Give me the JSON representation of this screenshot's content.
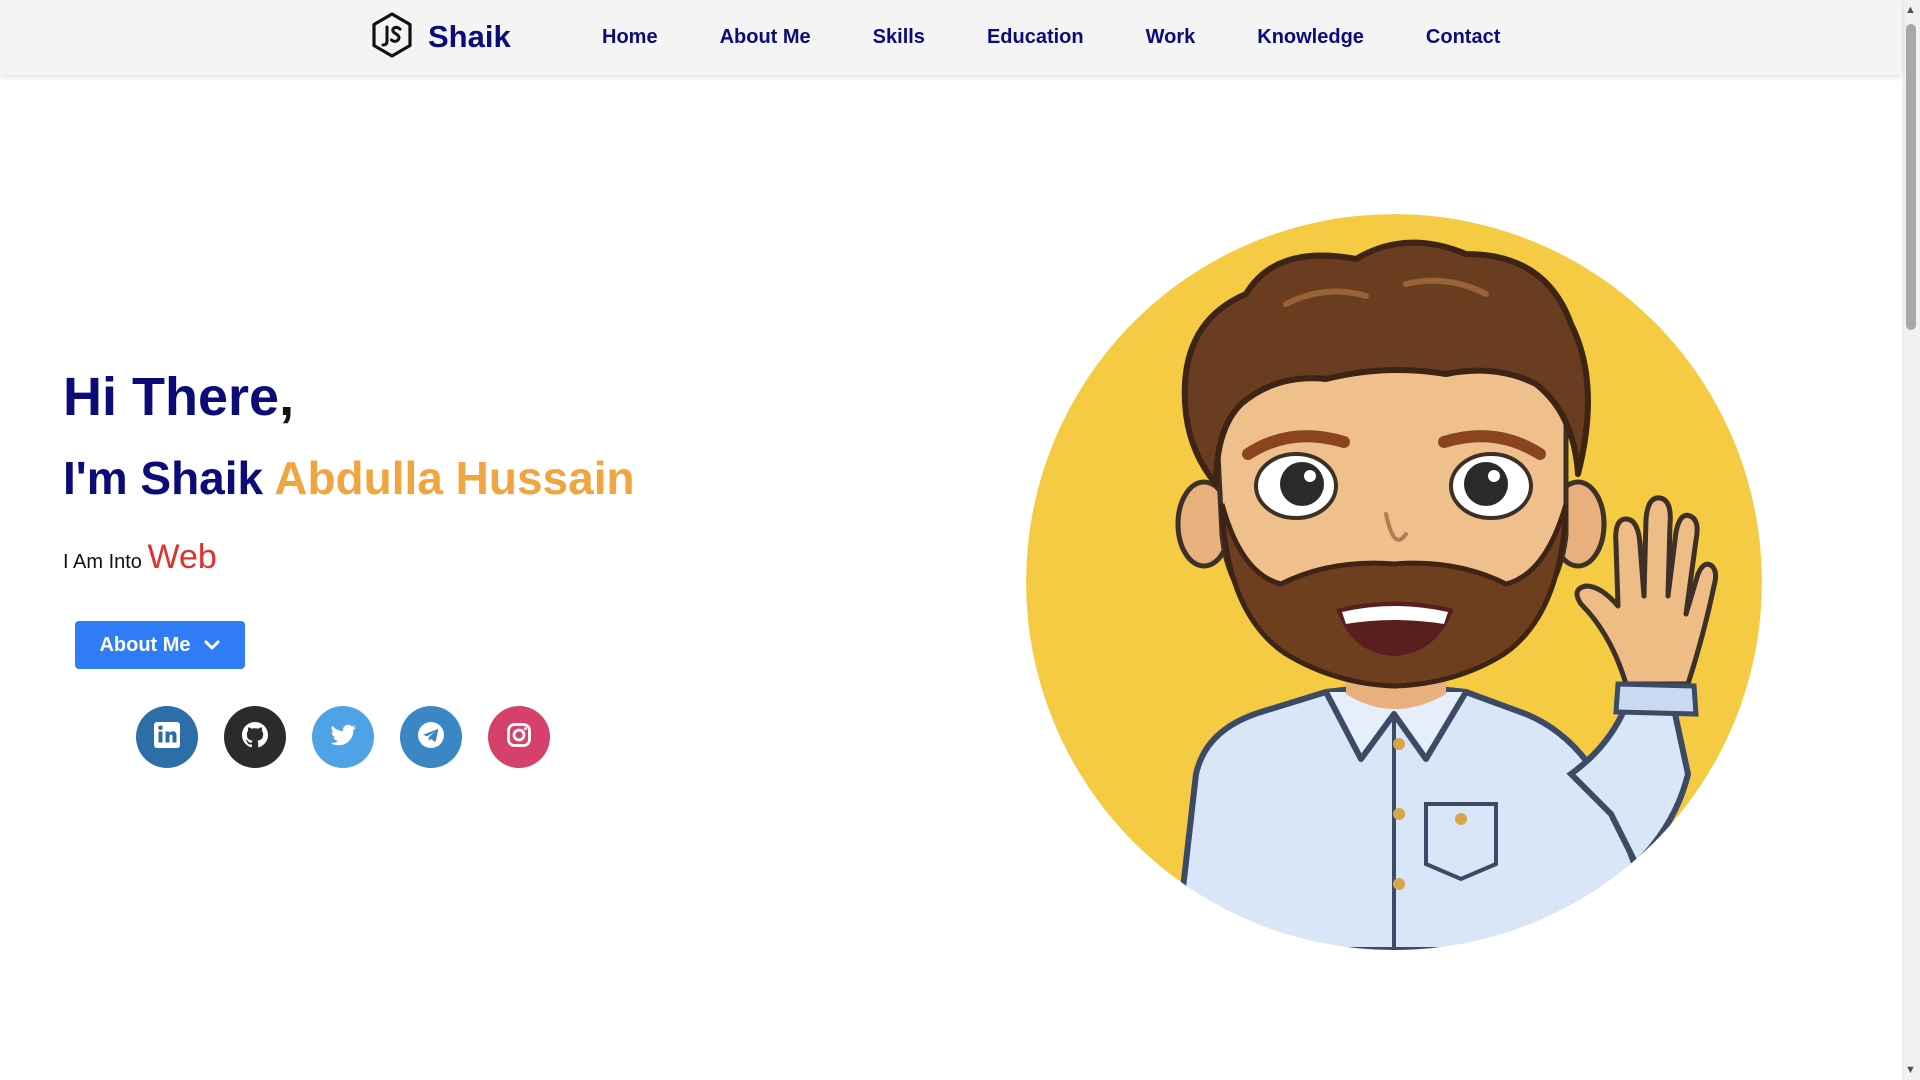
{
  "header": {
    "brand": "Shaik",
    "nav": [
      {
        "label": "Home"
      },
      {
        "label": "About Me"
      },
      {
        "label": "Skills"
      },
      {
        "label": "Education"
      },
      {
        "label": "Work"
      },
      {
        "label": "Knowledge"
      },
      {
        "label": "Contact"
      }
    ]
  },
  "hero": {
    "greeting": "Hi There",
    "greeting_punct": ",",
    "intro_prefix": "I'm Shaik",
    "intro_accent": "Abdulla Hussain",
    "into_label": "I Am Into",
    "typed_text": "Web",
    "about_button": "About Me"
  },
  "socials": [
    {
      "icon": "linkedin-icon",
      "color": "#2e6ea8"
    },
    {
      "icon": "github-icon",
      "color": "#2b2b2b"
    },
    {
      "icon": "twitter-icon",
      "color": "#4ea3e6"
    },
    {
      "icon": "telegram-icon",
      "color": "#3b86c4"
    },
    {
      "icon": "instagram-icon",
      "color": "#d6416b"
    }
  ],
  "colors": {
    "navy": "#0b0b7a",
    "accent_orange": "#f0a540",
    "typed_red": "#e0322b",
    "button_blue": "#2f7cf6",
    "avatar_bg": "#f4cb42"
  }
}
